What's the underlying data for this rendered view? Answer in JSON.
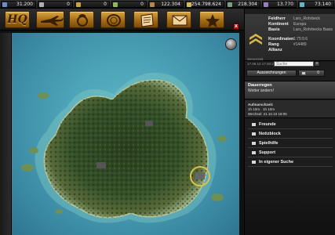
{
  "resources": [
    {
      "name": "resource-1",
      "value": "31.200",
      "color": "#6a8fcf"
    },
    {
      "name": "resource-2",
      "value": "0",
      "color": "#b0b0b0"
    },
    {
      "name": "resource-3",
      "value": "0",
      "color": "#c9a23a"
    },
    {
      "name": "resource-4",
      "value": "0",
      "color": "#8fb85a"
    },
    {
      "name": "resource-5",
      "value": "122.304",
      "color": "#b8864a"
    },
    {
      "name": "resource-6",
      "value": "254.798.624",
      "color": "#d6b860"
    },
    {
      "name": "resource-7",
      "value": "218.304",
      "color": "#7b9e7b"
    },
    {
      "name": "resource-8",
      "value": "13.770",
      "color": "#9a7bc0"
    },
    {
      "name": "resource-9",
      "value": "73.140",
      "color": "#5fb7c9"
    }
  ],
  "menu": {
    "hq_label": "HQ",
    "buttons": [
      "hq",
      "aircraft",
      "research",
      "alliance",
      "documents",
      "mail",
      "rankings"
    ],
    "close_label": "x"
  },
  "profile": {
    "labels": [
      "Feldherr",
      "Kontinent",
      "Basis",
      "Koordinaten",
      "Rang",
      "Allianz"
    ],
    "values": [
      "Lars_Rohrbeck",
      "Europa",
      "Lars_Rohrbecks Basis",
      "1:75:5:6",
      "#14489",
      ""
    ],
    "servertime_label": "Serverzeit",
    "servertime": "17.09.10 17:48:20 Uhr"
  },
  "search": {
    "placeholder": "Suche",
    "button": "»"
  },
  "awards_label": "Auszeichnungen",
  "messages_count": "0",
  "weather": {
    "title": "Dauerregen",
    "link": "Wetter ändern!"
  },
  "timers": {
    "line1": "Aufmarschzeit:",
    "line2": "1h 10m · 1h 10m",
    "line3": "Wechsel: 21.10.10 18:05"
  },
  "nav": [
    {
      "label": "Freunde"
    },
    {
      "label": "Notizblock"
    },
    {
      "label": "Spielhilfe"
    },
    {
      "label": "Support"
    },
    {
      "label": "In eigener Suche"
    }
  ]
}
